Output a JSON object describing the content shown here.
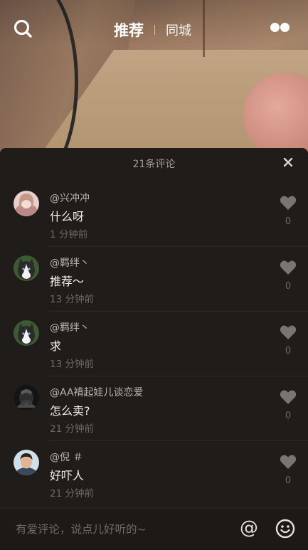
{
  "header": {
    "tabs": [
      {
        "label": "推荐",
        "active": true
      },
      {
        "label": "同城",
        "active": false
      }
    ],
    "icons": {
      "left": "search-icon",
      "right": "more-icon"
    }
  },
  "comments_panel": {
    "count_label": "21条评论",
    "close_icon": "close-icon",
    "comments": [
      {
        "username": "@兴冲冲",
        "text": "什么呀",
        "time": "1 分钟前",
        "likes": "0",
        "avatar": "avatar-girl"
      },
      {
        "username": "@羁绊丶",
        "text": "推荐～",
        "time": "13 分钟前",
        "likes": "0",
        "avatar": "avatar-husky"
      },
      {
        "username": "@羁绊丶",
        "text": "求",
        "time": "13 分钟前",
        "likes": "0",
        "avatar": "avatar-husky"
      },
      {
        "username": "@AA褙起娃儿谈恋爱",
        "text": "怎么卖?",
        "time": "21 分钟前",
        "likes": "0",
        "avatar": "avatar-dark"
      },
      {
        "username": "@倪 ＃",
        "text": "好吓人",
        "time": "21 分钟前",
        "likes": "0",
        "avatar": "avatar-man"
      }
    ]
  },
  "input_bar": {
    "placeholder": "有爱评论，说点儿好听的~",
    "at_symbol": "@",
    "emoji_icon": "smile-icon"
  },
  "colors": {
    "sheet_bg": "#201c1a",
    "text_primary": "#f2f0ed",
    "text_secondary": "#6e6964"
  }
}
